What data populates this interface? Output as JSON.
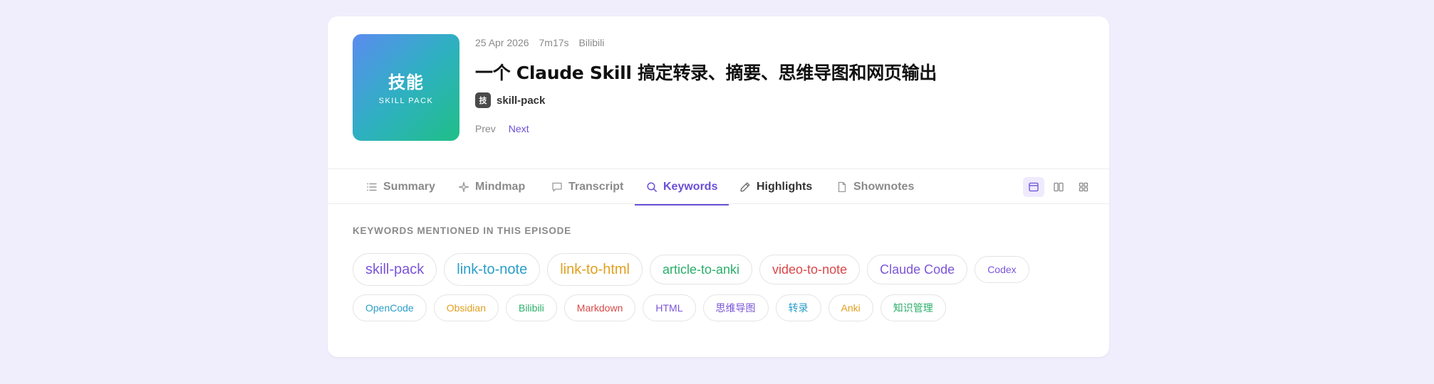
{
  "episode": {
    "cover": {
      "main": "技能",
      "sub": "SKILL PACK"
    },
    "meta": {
      "date": "25 Apr 2026",
      "duration": "7m17s",
      "source": "Bilibili"
    },
    "title": "一个 Claude Skill 搞定转录、摘要、思维导图和网页输出",
    "author": {
      "badge": "技",
      "name": "skill-pack"
    },
    "pager": {
      "prev": "Prev",
      "next": "Next"
    }
  },
  "tabs": [
    {
      "label": "Summary",
      "icon": "list-icon"
    },
    {
      "label": "Mindmap",
      "icon": "sparkle-icon"
    },
    {
      "label": "Transcript",
      "icon": "speech-bubble-icon"
    },
    {
      "label": "Keywords",
      "icon": "search-icon",
      "active": true
    },
    {
      "label": "Highlights",
      "icon": "pencil-icon"
    },
    {
      "label": "Shownotes",
      "icon": "document-icon"
    }
  ],
  "views": [
    "single-column-view-icon",
    "two-column-view-icon",
    "grid-view-icon"
  ],
  "keywords": {
    "heading": "KEYWORDS MENTIONED IN THIS EPISODE",
    "rows": [
      [
        {
          "text": "skill-pack",
          "color": "#7b55d8"
        },
        {
          "text": "link-to-note",
          "color": "#2a9ec9"
        },
        {
          "text": "link-to-html",
          "color": "#e0a020"
        },
        {
          "text": "article-to-anki",
          "color": "#2bae6a"
        },
        {
          "text": "video-to-note",
          "color": "#d94848"
        },
        {
          "text": "Claude Code",
          "color": "#7b55d8"
        },
        {
          "text": "Codex",
          "color": "#7b55d8"
        }
      ],
      [
        {
          "text": "OpenCode",
          "color": "#2a9ec9"
        },
        {
          "text": "Obsidian",
          "color": "#e0a020"
        },
        {
          "text": "Bilibili",
          "color": "#2bae6a"
        },
        {
          "text": "Markdown",
          "color": "#d94848"
        },
        {
          "text": "HTML",
          "color": "#7b55d8"
        },
        {
          "text": "思维导图",
          "color": "#7b55d8"
        },
        {
          "text": "转录",
          "color": "#2a9ec9"
        },
        {
          "text": "Anki",
          "color": "#e0a020"
        },
        {
          "text": "知识管理",
          "color": "#2bae6a"
        }
      ]
    ]
  }
}
